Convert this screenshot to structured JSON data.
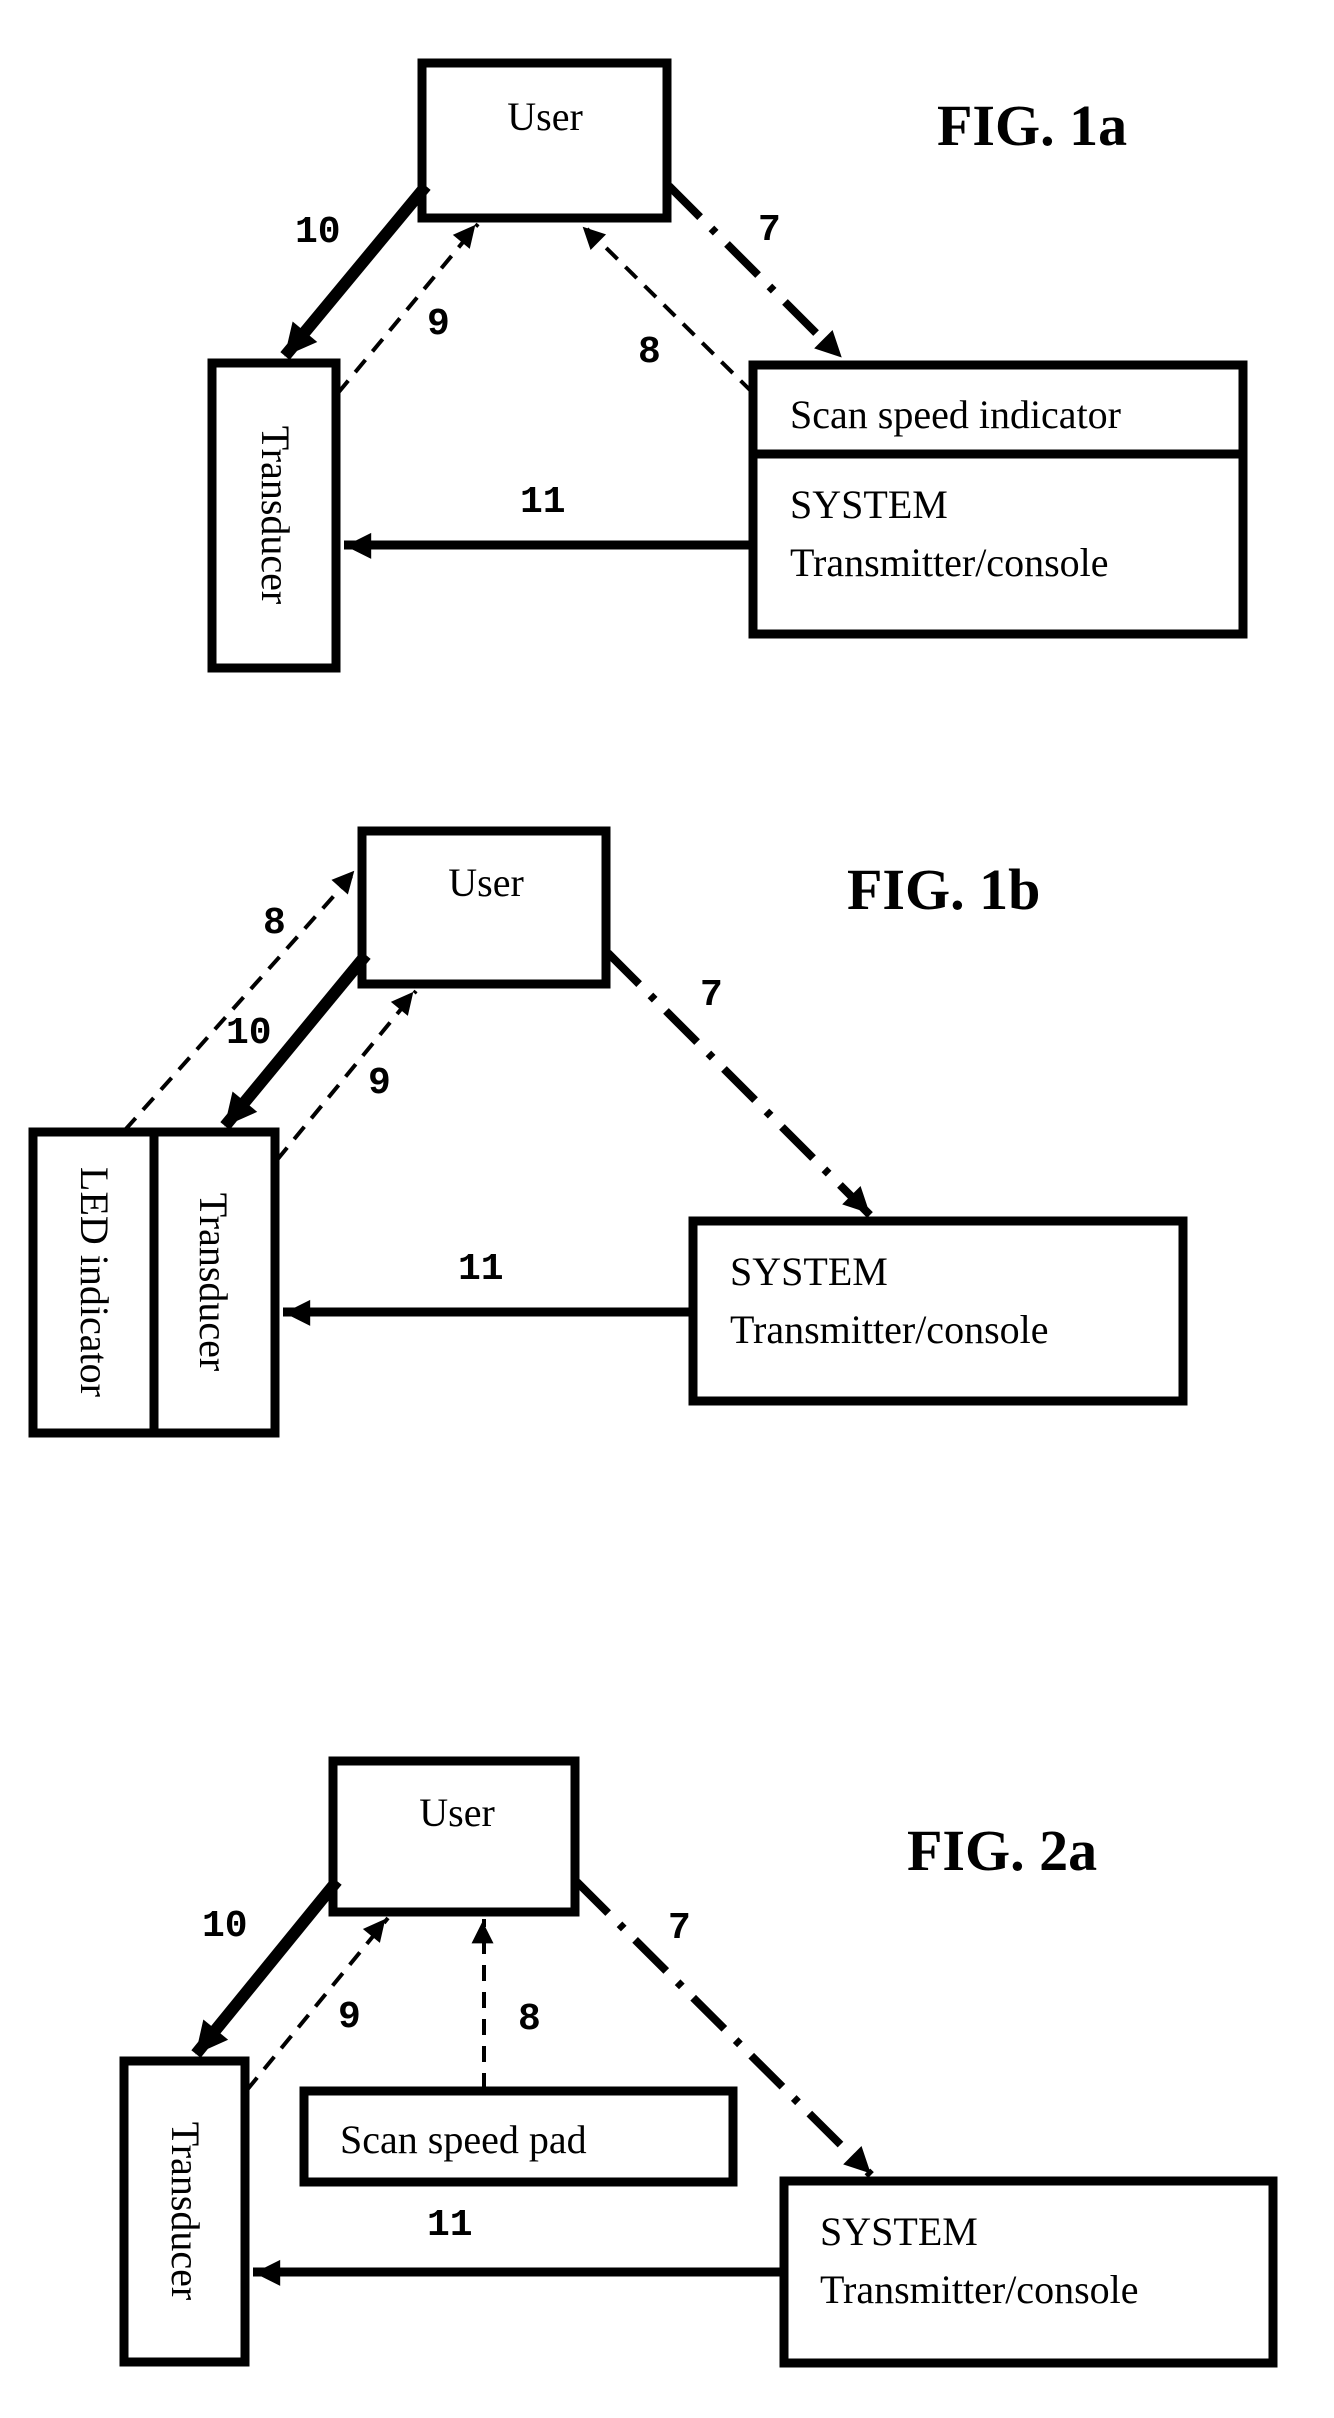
{
  "figures": [
    {
      "id": "fig1a",
      "title": "FIG. 1a",
      "user_label": "User",
      "transducer_label": "Transducer",
      "indicator_label": "Scan speed indicator",
      "system_line1": "SYSTEM",
      "system_line2": "Transmitter/console",
      "arrows": {
        "a10": "10",
        "a9": "9",
        "a8": "8",
        "a7": "7",
        "a11": "11"
      }
    },
    {
      "id": "fig1b",
      "title": "FIG. 1b",
      "user_label": "User",
      "led_label": "LED indicator",
      "transducer_label": "Transducer",
      "system_line1": "SYSTEM",
      "system_line2": "Transmitter/console",
      "arrows": {
        "a8": "8",
        "a10": "10",
        "a9": "9",
        "a7": "7",
        "a11": "11"
      }
    },
    {
      "id": "fig2a",
      "title": "FIG. 2a",
      "user_label": "User",
      "transducer_label": "Transducer",
      "pad_label": "Scan speed pad",
      "system_line1": "SYSTEM",
      "system_line2": "Transmitter/console",
      "arrows": {
        "a10": "10",
        "a9": "9",
        "a8": "8",
        "a7": "7",
        "a11": "11"
      }
    }
  ],
  "legend_line_styles": {
    "10": "thick solid",
    "11": "solid",
    "9": "dashed",
    "8": "dashed",
    "7": "dash-dot"
  }
}
